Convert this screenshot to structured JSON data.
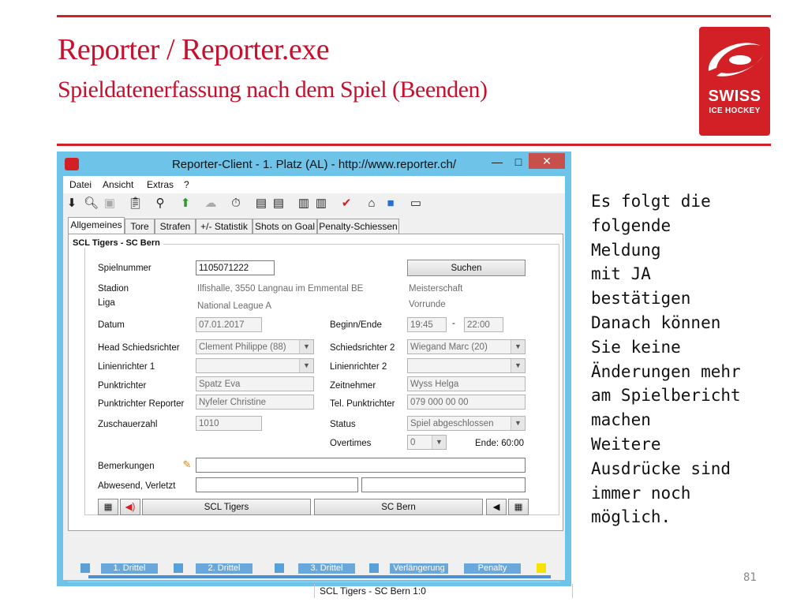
{
  "slide": {
    "title": "Reporter / Reporter.exe",
    "subtitle": "Spieldatenerfassung nach dem Spiel (Beenden)",
    "logo_line1": "SWISS",
    "logo_line2": "ICE HOCKEY",
    "side_text": "Es folgt die\nfolgende\nMeldung\nmit JA\nbestätigen\nDanach können\nSie keine\nÄnderungen mehr\nam Spielbericht\nmachen\nWeitere\nAusdrücke sind\nimmer noch\nmöglich.",
    "page_number": "81",
    "accent_color": "#c8102e"
  },
  "window": {
    "title": "Reporter-Client  -  1. Platz (AL)  -  http://www.reporter.ch/",
    "minimize": "—",
    "maximize": "□",
    "close": "✕",
    "menu": [
      "Datei",
      "Ansicht",
      "Extras",
      "?"
    ],
    "tabs": [
      "Allgemeines",
      "Tore",
      "Strafen",
      "+/- Statistik",
      "Shots on Goal",
      "Penalty-Schiessen"
    ],
    "active_tab": "Allgemeines"
  },
  "form": {
    "group_title": "SCL Tigers - SC Bern",
    "spielnummer_label": "Spielnummer",
    "spielnummer": "1105071222",
    "suchen": "Suchen",
    "stadion_label": "Stadion",
    "stadion": "Ilfishalle, 3550 Langnau im Emmental BE",
    "wettbewerb": "Meisterschaft",
    "liga_label": "Liga",
    "liga": "National League A",
    "phase": "Vorrunde",
    "datum_label": "Datum",
    "datum": "07.01.2017",
    "beginn_label": "Beginn/Ende",
    "beginn": "19:45",
    "dash": "-",
    "ende": "22:00",
    "head_sr_label": "Head Schiedsrichter",
    "head_sr": "Clement Philippe (88)",
    "sr2_label": "Schiedsrichter 2",
    "sr2": "Wiegand Marc (20)",
    "lr1_label": "Linienrichter 1",
    "lr1": "",
    "lr2_label": "Linienrichter 2",
    "lr2": "",
    "punktrichter_label": "Punktrichter",
    "punktrichter": "Spatz Eva",
    "zeitnehmer_label": "Zeitnehmer",
    "zeitnehmer": "Wyss Helga",
    "pr_reporter_label": "Punktrichter Reporter",
    "pr_reporter": "Nyfeler Christine",
    "tel_label": "Tel. Punktrichter",
    "tel": "079 000 00 00",
    "zuschauer_label": "Zuschauerzahl",
    "zuschauer": "1010",
    "status_label": "Status",
    "status": "Spiel abgeschlossen",
    "overtimes_label": "Overtimes",
    "overtimes": "0",
    "ende_label": "Ende: 60:00",
    "bemerkungen_label": "Bemerkungen",
    "abwesend_label": "Abwesend, Verletzt",
    "team_home": "SCL Tigers",
    "team_away": "SC Bern"
  },
  "timeline": {
    "segments": [
      "1. Drittel",
      "2. Drittel",
      "3. Drittel",
      "Verlängerung",
      "Penalty"
    ]
  },
  "statusbar": {
    "score": "SCL Tigers - SC Bern 1:0"
  }
}
